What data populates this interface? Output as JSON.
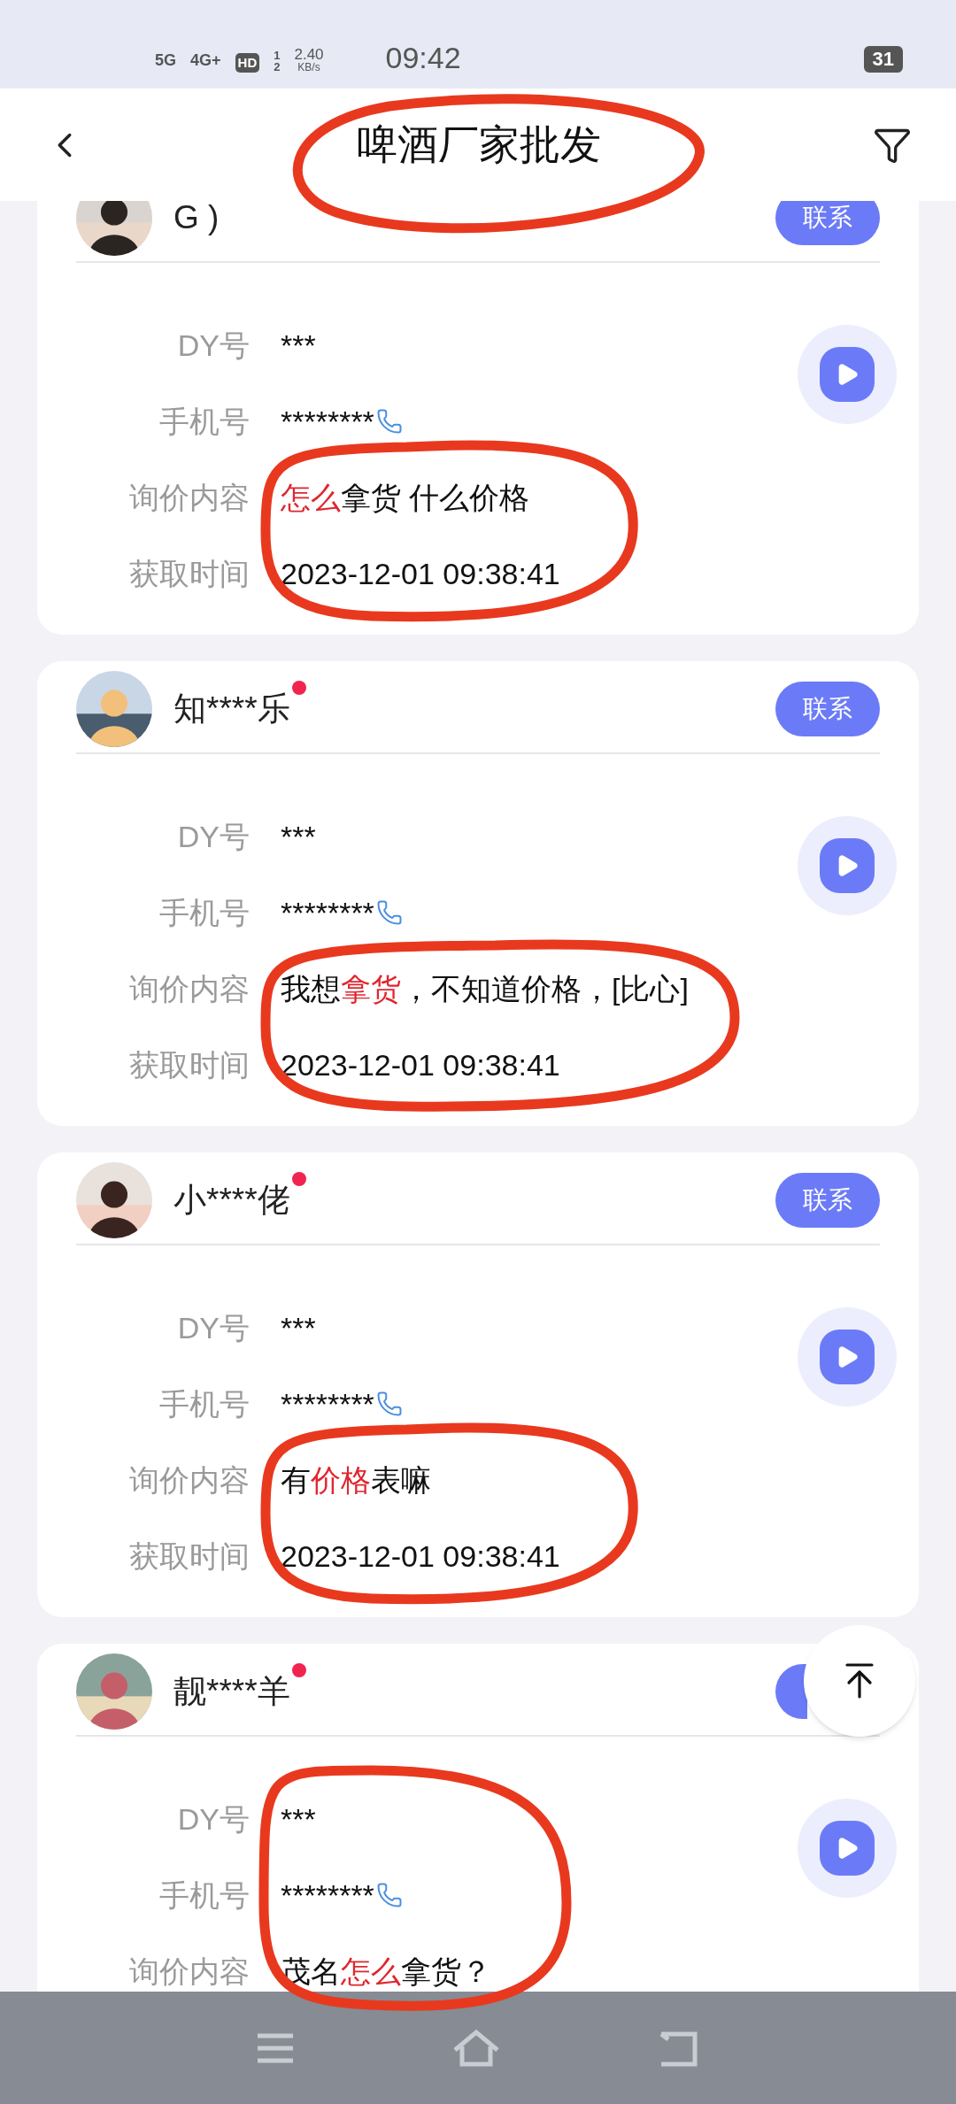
{
  "status_bar": {
    "network_1": "5G",
    "network_2": "4G+",
    "hd": "HD",
    "hd_sup": "1",
    "hd_sub": "2",
    "speed": "2.40",
    "speed_unit": "KB/s",
    "time": "09:42",
    "battery": "31"
  },
  "header": {
    "title": "啤酒厂家批发"
  },
  "cards": [
    {
      "name": "G )",
      "unread": false,
      "contact": "联系",
      "fields": [
        {
          "label": "DY号",
          "value": [
            {
              "text": "***",
              "highlight": false
            }
          ],
          "kind": "text"
        },
        {
          "label": "手机号",
          "value": [
            {
              "text": "********",
              "highlight": false
            }
          ],
          "kind": "phone"
        },
        {
          "label": "询价内容",
          "value": [
            {
              "text": "怎么",
              "highlight": true
            },
            {
              "text": "拿货 什么价格",
              "highlight": false
            }
          ],
          "kind": "text"
        },
        {
          "label": "获取时间",
          "value": [
            {
              "text": "2023-12-01 09:38:41",
              "highlight": false
            }
          ],
          "kind": "text"
        }
      ]
    },
    {
      "name": "知****乐",
      "unread": true,
      "contact": "联系",
      "fields": [
        {
          "label": "DY号",
          "value": [
            {
              "text": "***",
              "highlight": false
            }
          ],
          "kind": "text"
        },
        {
          "label": "手机号",
          "value": [
            {
              "text": "********",
              "highlight": false
            }
          ],
          "kind": "phone"
        },
        {
          "label": "询价内容",
          "value": [
            {
              "text": "我想",
              "highlight": false
            },
            {
              "text": "拿货",
              "highlight": true
            },
            {
              "text": "，不知道价格，[比心]",
              "highlight": false
            }
          ],
          "kind": "text"
        },
        {
          "label": "获取时间",
          "value": [
            {
              "text": "2023-12-01 09:38:41",
              "highlight": false
            }
          ],
          "kind": "text"
        }
      ]
    },
    {
      "name": "小****佬",
      "unread": true,
      "contact": "联系",
      "fields": [
        {
          "label": "DY号",
          "value": [
            {
              "text": "***",
              "highlight": false
            }
          ],
          "kind": "text"
        },
        {
          "label": "手机号",
          "value": [
            {
              "text": "********",
              "highlight": false
            }
          ],
          "kind": "phone"
        },
        {
          "label": "询价内容",
          "value": [
            {
              "text": "有",
              "highlight": false
            },
            {
              "text": "价格",
              "highlight": true
            },
            {
              "text": "表嘛",
              "highlight": false
            }
          ],
          "kind": "text"
        },
        {
          "label": "获取时间",
          "value": [
            {
              "text": "2023-12-01 09:38:41",
              "highlight": false
            }
          ],
          "kind": "text"
        }
      ]
    },
    {
      "name": "靓****羊",
      "unread": true,
      "fields": [
        {
          "label": "DY号",
          "value": [
            {
              "text": "***",
              "highlight": false
            }
          ],
          "kind": "text"
        },
        {
          "label": "手机号",
          "value": [
            {
              "text": "********",
              "highlight": false
            }
          ],
          "kind": "phone"
        },
        {
          "label": "询价内容",
          "value": [
            {
              "text": "茂名",
              "highlight": false
            },
            {
              "text": "怎么",
              "highlight": true
            },
            {
              "text": "拿货？",
              "highlight": false
            }
          ],
          "kind": "text"
        }
      ]
    }
  ]
}
